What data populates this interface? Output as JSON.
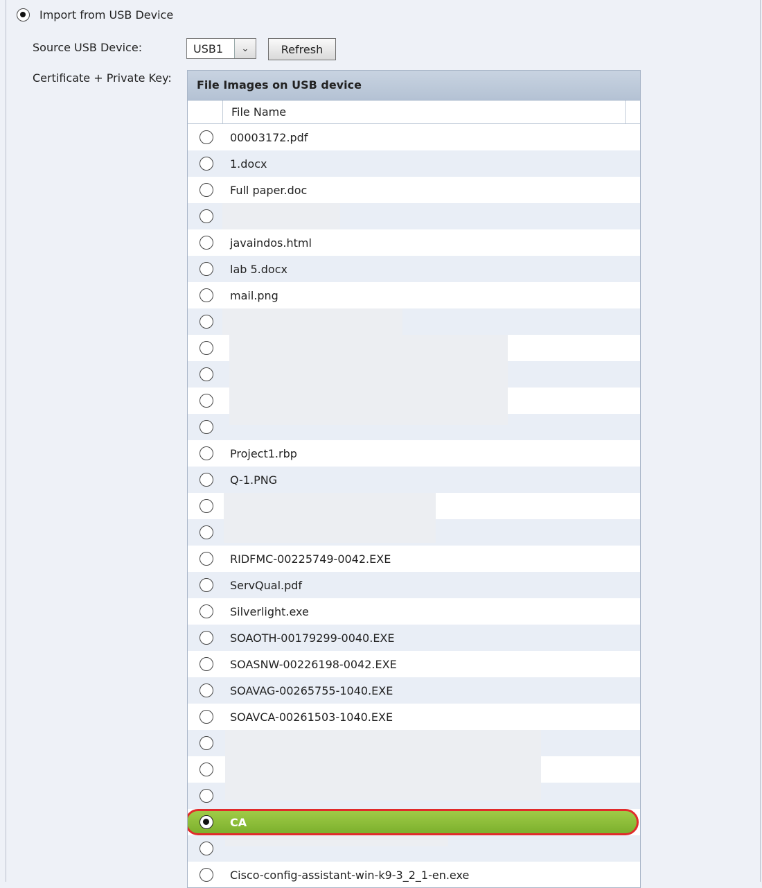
{
  "import": {
    "label": "Import from USB Device",
    "checked": true
  },
  "source": {
    "label": "Source USB Device:",
    "selected": "USB1",
    "refresh_label": "Refresh"
  },
  "key": {
    "label": "Certificate + Private Key:"
  },
  "table": {
    "title": "File Images on USB device",
    "column_header": "File Name",
    "rows": [
      {
        "name": "00003172.pdf",
        "checked": false
      },
      {
        "name": "1.docx",
        "checked": false
      },
      {
        "name": "Full paper.doc",
        "checked": false
      },
      {
        "name": "",
        "checked": false
      },
      {
        "name": "javaindos.html",
        "checked": false
      },
      {
        "name": "lab 5.docx",
        "checked": false
      },
      {
        "name": "mail.png",
        "checked": false
      },
      {
        "name": "",
        "checked": false
      },
      {
        "name": "",
        "checked": false
      },
      {
        "name": "",
        "checked": false
      },
      {
        "name": "",
        "checked": false
      },
      {
        "name": "",
        "checked": false
      },
      {
        "name": "Project1.rbp",
        "checked": false
      },
      {
        "name": "Q-1.PNG",
        "checked": false
      },
      {
        "name": "",
        "checked": false
      },
      {
        "name": "",
        "checked": false
      },
      {
        "name": "RIDFMC-00225749-0042.EXE",
        "checked": false
      },
      {
        "name": "ServQual.pdf",
        "checked": false
      },
      {
        "name": "Silverlight.exe",
        "checked": false
      },
      {
        "name": "SOAOTH-00179299-0040.EXE",
        "checked": false
      },
      {
        "name": "SOASNW-00226198-0042.EXE",
        "checked": false
      },
      {
        "name": "SOAVAG-00265755-1040.EXE",
        "checked": false
      },
      {
        "name": "SOAVCA-00261503-1040.EXE",
        "checked": false
      },
      {
        "name": "",
        "checked": false
      },
      {
        "name": "",
        "checked": false
      },
      {
        "name": "",
        "checked": false
      },
      {
        "name": "CA",
        "checked": true,
        "selected": true
      },
      {
        "name": "",
        "checked": false
      },
      {
        "name": "Cisco-config-assistant-win-k9-3_2_1-en.exe",
        "checked": false
      }
    ]
  },
  "colors": {
    "selected_row": "#8dbd3a",
    "highlight_outline": "#e02b2b",
    "header_bg": "#bcc8d8"
  }
}
